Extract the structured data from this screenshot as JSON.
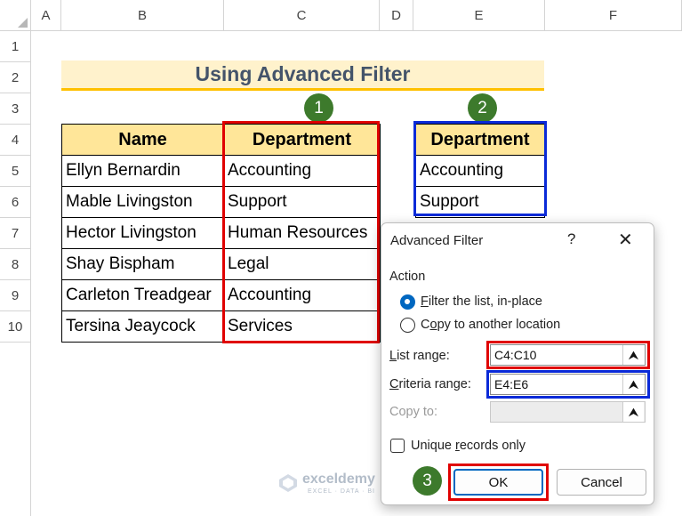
{
  "columns": [
    "A",
    "B",
    "C",
    "D",
    "E",
    "F"
  ],
  "rows": [
    "1",
    "2",
    "3",
    "4",
    "5",
    "6",
    "7",
    "8",
    "9",
    "10"
  ],
  "title": "Using Advanced Filter",
  "main_table": {
    "headers": [
      "Name",
      "Department"
    ],
    "rows": [
      [
        "Ellyn Bernardin",
        "Accounting"
      ],
      [
        "Mable Livingston",
        "Support"
      ],
      [
        "Hector Livingston",
        "Human Resources"
      ],
      [
        "Shay Bispham",
        "Legal"
      ],
      [
        "Carleton Treadgear",
        "Accounting"
      ],
      [
        "Tersina Jeaycock",
        "Services"
      ]
    ]
  },
  "criteria_table": {
    "header": "Department",
    "rows": [
      "Accounting",
      "Support"
    ]
  },
  "badges": [
    "1",
    "2",
    "3"
  ],
  "dialog": {
    "title": "Advanced Filter",
    "help": "?",
    "close": "✕",
    "action_label": "Action",
    "option_filter_u": "F",
    "option_filter_rest": "ilter the list, in-place",
    "option_copy_pre": "C",
    "option_copy_u": "o",
    "option_copy_rest": "py to another location",
    "list_range_u": "L",
    "list_range_rest": "ist range:",
    "list_range_value": "C4:C10",
    "criteria_range_u": "C",
    "criteria_range_rest": "riteria range:",
    "criteria_range_value": "E4:E6",
    "copy_to_label": "Copy to:",
    "copy_to_value": "",
    "unique_pre": "Unique ",
    "unique_u": "r",
    "unique_rest": "ecords only",
    "ok_label": "OK",
    "cancel_label": "Cancel",
    "selected_option": "filter_in_place",
    "unique_checked": false
  },
  "watermark": {
    "name": "exceldemy",
    "tagline": "EXCEL · DATA · BI"
  },
  "colors": {
    "title_fill": "#fff2cc",
    "title_underline": "#ffc000",
    "header_fill": "#ffe699",
    "red_highlight": "#e00000",
    "blue_highlight": "#0a2ad8",
    "badge_green": "#3d7a2c",
    "accent": "#0067c0"
  }
}
